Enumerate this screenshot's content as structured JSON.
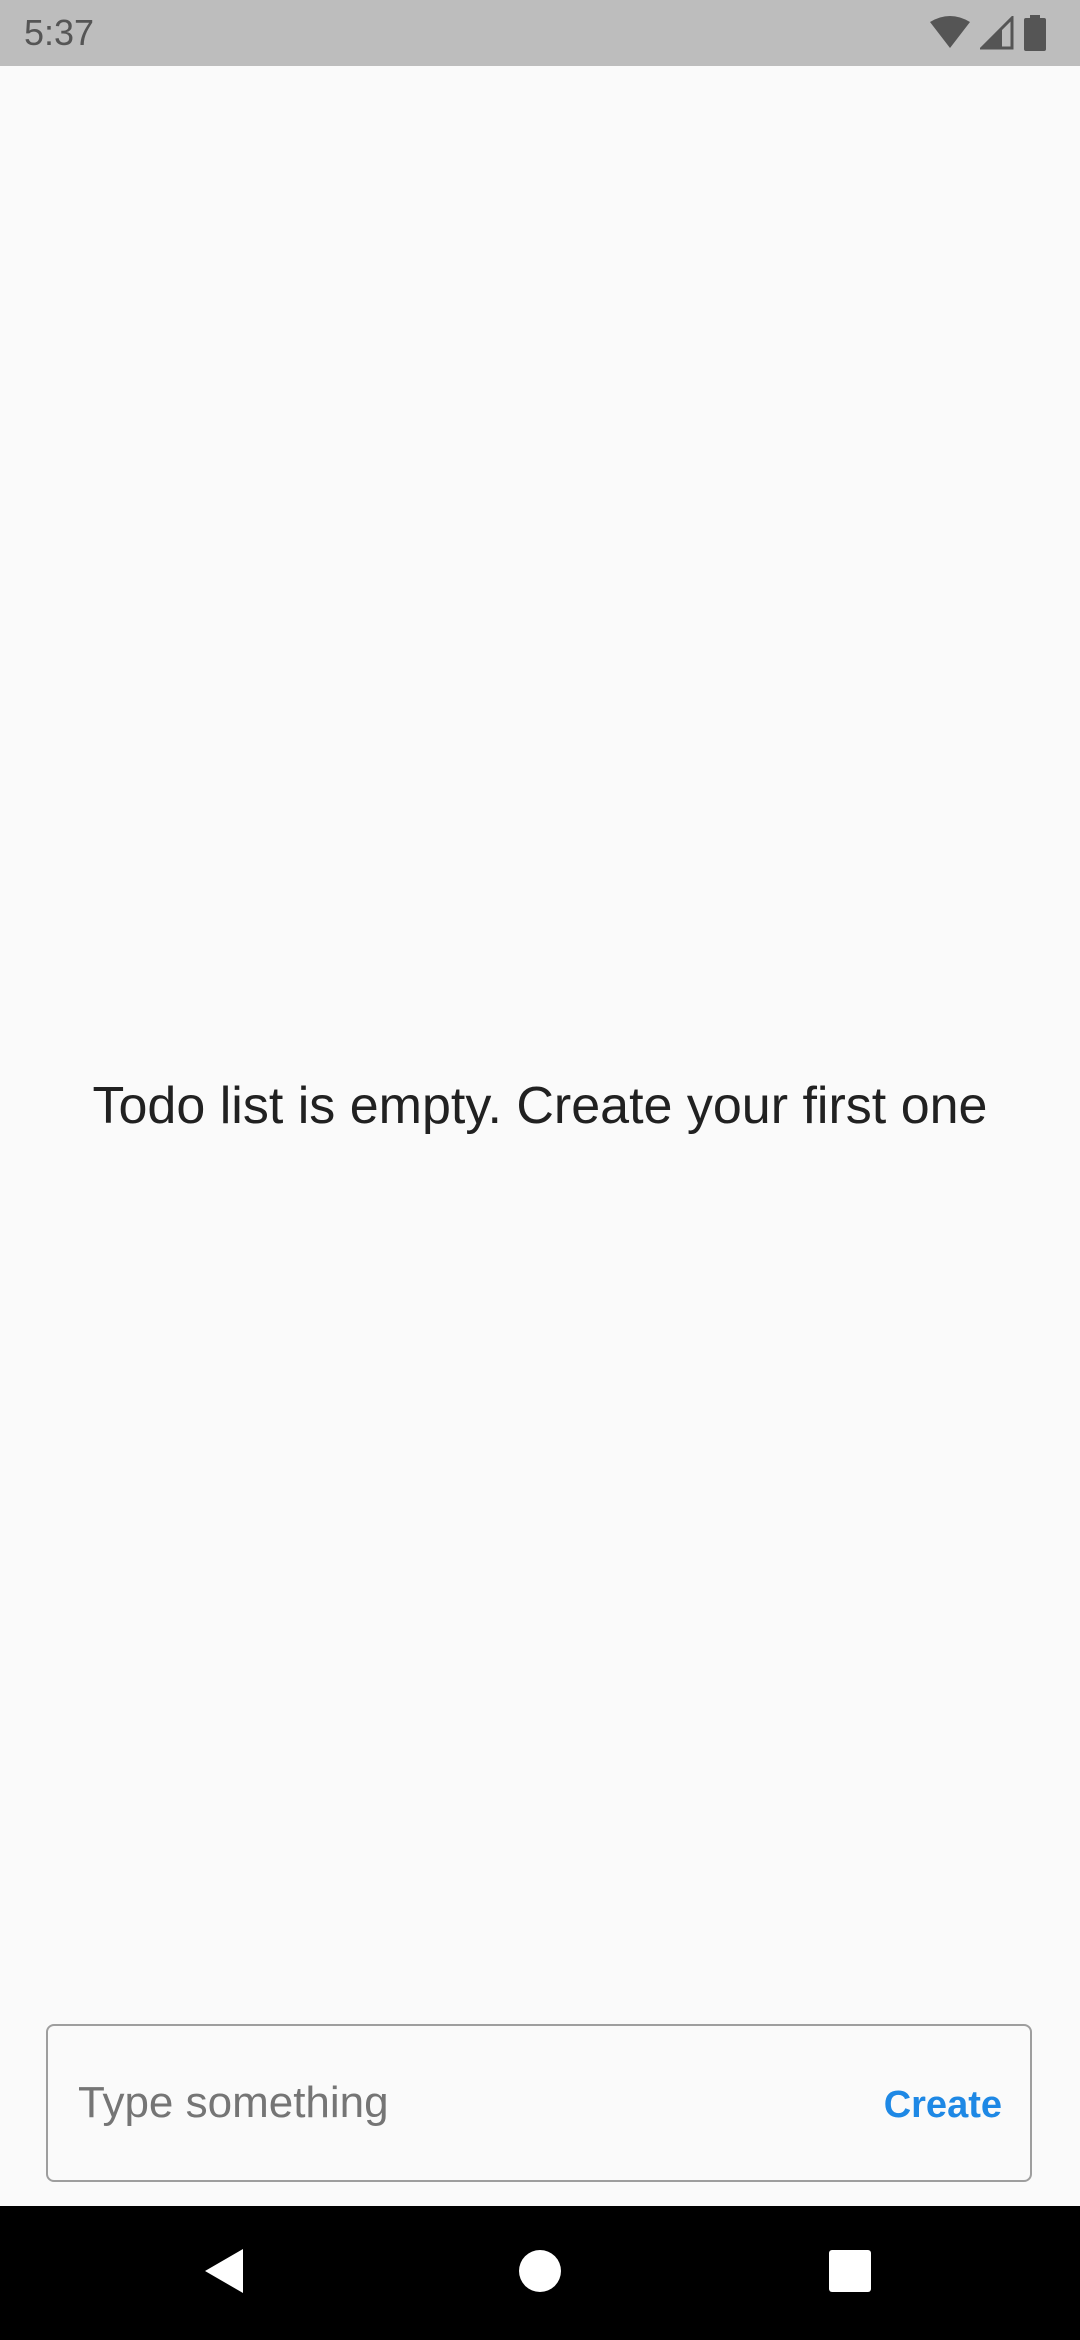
{
  "status_bar": {
    "time": "5:37",
    "icons": [
      "wifi-icon",
      "cell-signal-icon",
      "battery-icon"
    ]
  },
  "main": {
    "empty_message": "Todo list is empty. Create your first one"
  },
  "input": {
    "placeholder": "Type something",
    "value": "",
    "create_label": "Create"
  },
  "nav_bar": {
    "icons": [
      "back-icon",
      "home-icon",
      "recents-icon"
    ]
  },
  "colors": {
    "status_bar_bg": "#bdbdbd",
    "background": "#fafafa",
    "accent": "#1e88e5",
    "nav_bar_bg": "#000000"
  }
}
